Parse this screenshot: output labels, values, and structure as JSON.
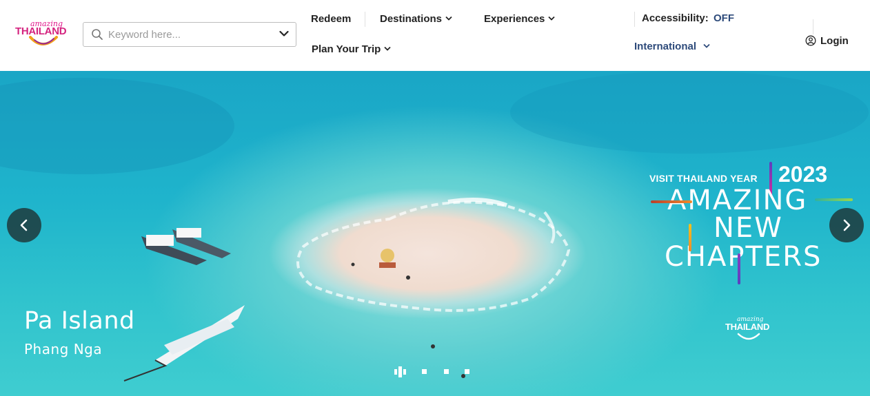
{
  "header": {
    "logo": {
      "small_text": "amazing",
      "big_text": "THAILAND"
    },
    "search": {
      "placeholder": "Keyword here..."
    },
    "nav": {
      "redeem": "Redeem",
      "destinations": "Destinations",
      "experiences": "Experiences",
      "plan_trip": "Plan Your Trip"
    },
    "accessibility": {
      "label": "Accessibility:",
      "value": "OFF"
    },
    "language": "International",
    "login": "Login"
  },
  "hero": {
    "place": "Pa Island",
    "region": "Phang Nga",
    "campaign": {
      "line1": "VISIT THAILAND YEAR",
      "year": "2023",
      "line2": "AMAZING",
      "line3": "NEW",
      "line4": "CHAPTERS"
    },
    "badge": {
      "small_text": "amazing",
      "big_text": "THAILAND"
    },
    "slides_count": 4,
    "active_slide": 1
  },
  "colors": {
    "brand_pink": "#d4237f",
    "link_blue": "#2d4a7a",
    "sea": "#1fb4cc"
  }
}
